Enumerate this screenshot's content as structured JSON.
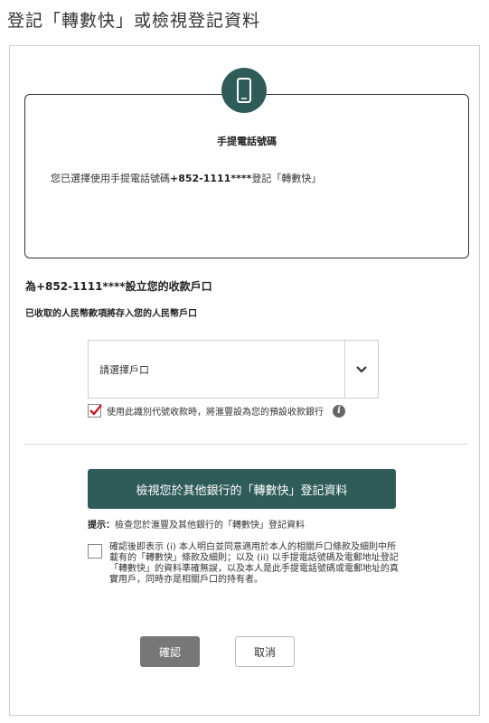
{
  "page": {
    "title": "登記「轉數快」或檢視登記資料"
  },
  "card": {
    "icon": "mobile-phone-icon",
    "title": "手提電話號碼",
    "text_prefix": "您已選擇使用手提電話號碼",
    "phone": "+852-1111****",
    "text_suffix": "登記「轉數快」"
  },
  "account": {
    "title": "為+852-1111****設立您的收款戶口",
    "subtitle": "已收取的人民幣款項將存入您的人民幣戶口",
    "select_value": "請選擇戶口",
    "default_bank_label": "使用此識別代號收款時，將滙豐設為您的預設收款銀行",
    "default_checked": true
  },
  "view_button": {
    "label": "檢視您於其他銀行的「轉數快」登記資料"
  },
  "hint": {
    "label": "提示：",
    "text": "檢查您於滙豐及其他銀行的「轉數快」登記資料"
  },
  "terms": {
    "checked": false,
    "text": "確認後即表示 (i) 本人明白並同意適用於本人的相關戶口條款及細則中所載有的「轉數快」條款及細則；以及 (ii) 以手提電話號碼及電郵地址登記「轉數快」的資料準確無誤，以及本人是此手提電話號碼或電郵地址的真實用戶，同時亦是相關戶口的持有者。"
  },
  "actions": {
    "confirm": "確認",
    "cancel": "取消"
  },
  "colors": {
    "brand": "#2f5c59",
    "check_red": "#d0021b",
    "confirm_gray": "#777777"
  }
}
